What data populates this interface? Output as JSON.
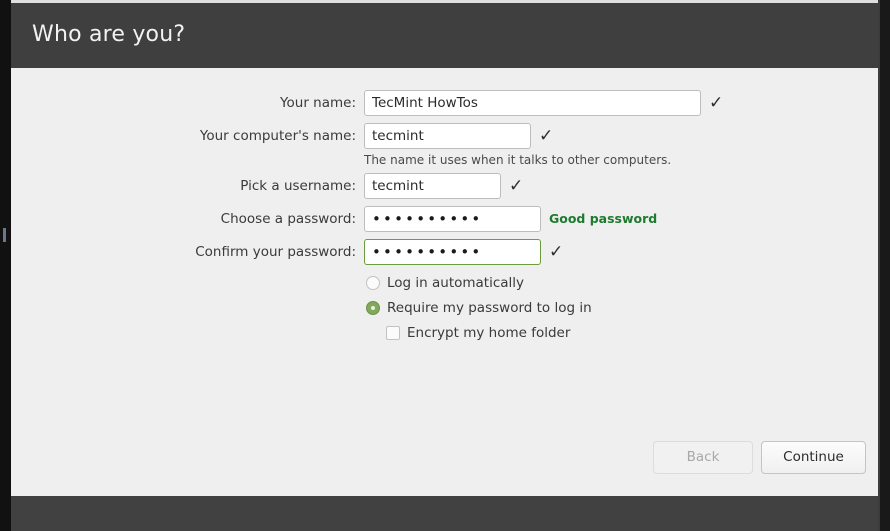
{
  "window": {
    "header_title": "Who are you?"
  },
  "form": {
    "fields": [
      {
        "label": "Your name:",
        "value": "TecMint HowTos",
        "validated": true,
        "check_icon": "check-icon"
      },
      {
        "label": "Your computer's name:",
        "value": "tecmint",
        "validated": true,
        "check_icon": "check-icon",
        "hint": "The name it uses when it talks to other computers."
      },
      {
        "label": "Pick a username:",
        "value": "tecmint",
        "validated": true,
        "check_icon": "check-icon"
      },
      {
        "label": "Choose a password:",
        "value": "••••••••••",
        "strength": "Good password",
        "validated": false
      },
      {
        "label": "Confirm your password:",
        "value": "••••••••••",
        "validated": true,
        "check_icon": "check-icon"
      }
    ]
  },
  "options": {
    "login_automatically": {
      "label": "Log in automatically",
      "selected": false
    },
    "require_password": {
      "label": "Require my password to log in",
      "selected": true
    },
    "encrypt_home": {
      "label": "Encrypt my home folder",
      "checked": false
    }
  },
  "actions": {
    "back_label": "Back",
    "back_disabled": true,
    "continue_label": "Continue",
    "continue_disabled": false
  },
  "colors": {
    "header_bg": "#3f3f3f",
    "content_bg": "#efefef",
    "footer_bg": "#414141",
    "accent_green": "#82a85c",
    "valid_border_green": "#6d9b3f",
    "strength_text_green": "#1d7a2e",
    "desktop_bg": "#121212"
  }
}
